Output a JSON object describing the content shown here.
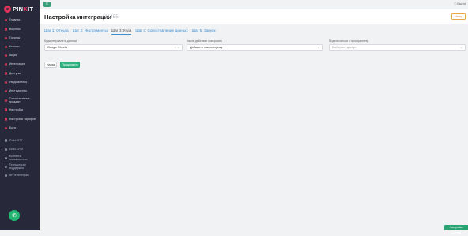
{
  "logo": {
    "pre": "PIN",
    "accent": "K",
    "post": "IT"
  },
  "sidebar": {
    "main": [
      {
        "label": "Главная",
        "icon": "home-icon"
      },
      {
        "label": "Воронки",
        "icon": "funnel-icon"
      },
      {
        "label": "Тарифы",
        "icon": "tag-icon"
      },
      {
        "label": "Каналы",
        "icon": "channel-icon"
      },
      {
        "label": "Акции",
        "icon": "gift-icon"
      },
      {
        "label": "Интеграции",
        "icon": "puzzle-icon"
      },
      {
        "label": "Доступы",
        "icon": "key-icon"
      },
      {
        "label": "Уведомления",
        "icon": "bell-icon"
      },
      {
        "label": "Инструменты",
        "icon": "wrench-icon"
      },
      {
        "label": "Сопоставление граждан",
        "icon": "link-icon"
      },
      {
        "label": "Настройки",
        "icon": "gear-icon"
      },
      {
        "label": "Настройки тарифов",
        "icon": "sliders-icon"
      },
      {
        "label": "Боты",
        "icon": "robot-icon"
      }
    ],
    "bottom": [
      {
        "label": "Pinkit CTT",
        "icon": "apps-icon"
      },
      {
        "label": "Lead CRM",
        "icon": "crm-icon"
      },
      {
        "label": "Контакты пользователя",
        "icon": "contacts-icon"
      },
      {
        "label": "Техническая поддержка",
        "icon": "support-icon"
      },
      {
        "label": "API в телеграм",
        "icon": "api-icon"
      }
    ]
  },
  "topbar": {
    "menu_glyph": "≡",
    "logout_label": "Выйти"
  },
  "header": {
    "title": "Настройка интеграции",
    "id": "#11455",
    "back_label": "Назад"
  },
  "tabs": [
    {
      "label": "Шаг 1: Откуда",
      "active": false
    },
    {
      "label": "Шаг 2: Инструменты",
      "active": false
    },
    {
      "label": "Шаг 3: Куда",
      "active": true
    },
    {
      "label": "Шаг 4: Сопоставление данных",
      "active": false
    },
    {
      "label": "Шаг 5: Запуск",
      "active": false
    }
  ],
  "fields": {
    "destination": {
      "label": "Куда отправлять данные",
      "value": "Google Sheets",
      "controls": "× ⌄"
    },
    "action": {
      "label": "Какое действие совершать",
      "value": "Добавить новую строку",
      "controls": "⌄"
    },
    "connection": {
      "label": "Подключиться к пространству",
      "placeholder": "Выберите доступ",
      "controls": "⌄"
    }
  },
  "buttons": {
    "back": "Назад",
    "next": "Продолжить"
  },
  "help_tab": "Настройка доступа",
  "colors": {
    "sidebar": "#27293a",
    "accent": "#e0345a",
    "primary": "#2fb380",
    "link": "#3f8fd0"
  }
}
